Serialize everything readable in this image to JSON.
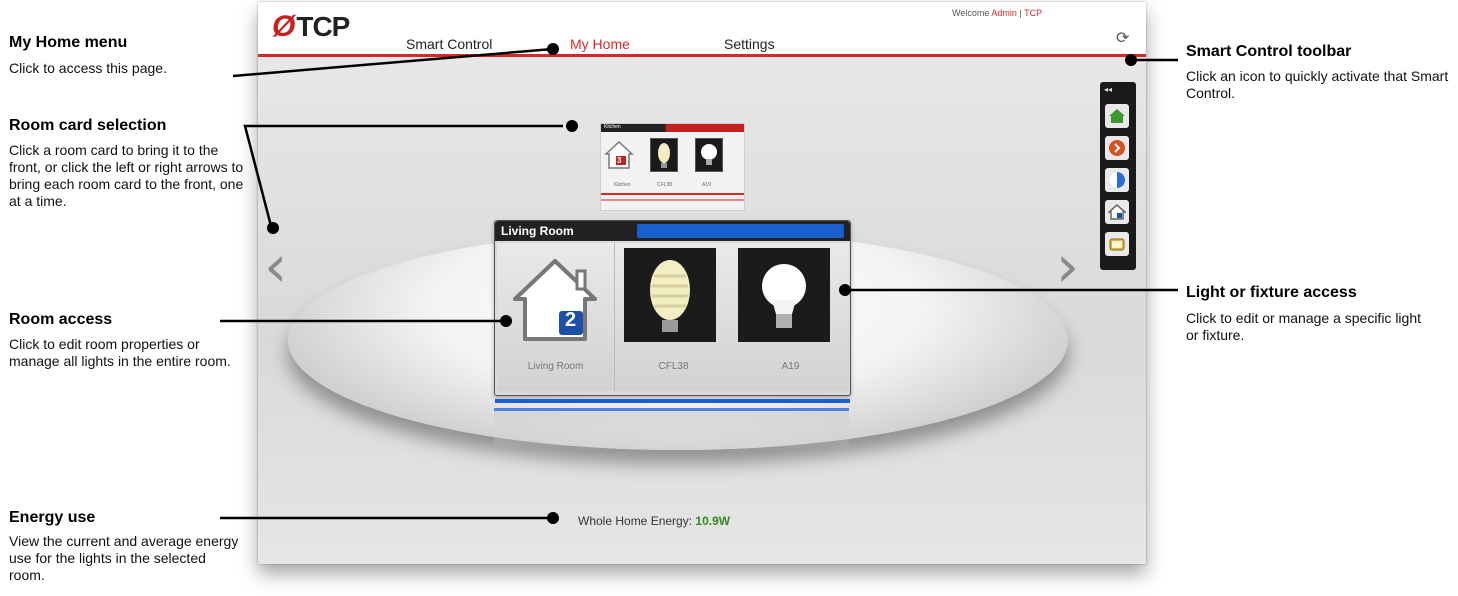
{
  "callouts": {
    "my_home_menu": {
      "title": "My Home menu",
      "text": "Click to access this page."
    },
    "room_card_selection": {
      "title": "Room card selection",
      "text": "Click a room card to bring it to the front, or click the left or right arrows to bring each room card to the front, one at a time."
    },
    "room_access": {
      "title": "Room access",
      "text": "Click to edit room properties or manage all lights in the entire room."
    },
    "energy_use": {
      "title": "Energy use",
      "text": "View the current and average energy use for the lights in the selected room."
    },
    "smart_control_toolbar": {
      "title": "Smart Control toolbar",
      "text": "Click an icon to quickly activate that Smart Control."
    },
    "light_fixture_access": {
      "title": "Light or fixture access",
      "text": "Click to edit or manage a specific light or fixture."
    }
  },
  "header": {
    "logo": "TCP",
    "nav": [
      "Smart Control",
      "My Home",
      "Settings"
    ],
    "active_nav": "My Home",
    "welcome_prefix": "Welcome",
    "user": "Admin",
    "separator": "|",
    "account": "TCP"
  },
  "room_card": {
    "title": "Living Room",
    "items": [
      {
        "label": "Living Room",
        "badge": "2",
        "icon": "house-icon"
      },
      {
        "label": "CFL38",
        "icon": "cfl-bulb-icon"
      },
      {
        "label": "A19",
        "icon": "a19-bulb-icon"
      }
    ]
  },
  "back_card": {
    "title": "Kitchen",
    "badge": "3",
    "items": [
      "Kitchen",
      "CFL38",
      "A19"
    ]
  },
  "energy": {
    "label": "Whole Home Energy:",
    "value": "10.9W"
  },
  "toolbar": {
    "collapse": "◂◂",
    "buttons": [
      "home-icon",
      "away-icon",
      "night-icon",
      "room-icon",
      "tv-icon"
    ]
  },
  "colors": {
    "accent_red": "#d42a2a",
    "accent_blue": "#1a5fd0",
    "energy_green": "#2f8a1e"
  }
}
